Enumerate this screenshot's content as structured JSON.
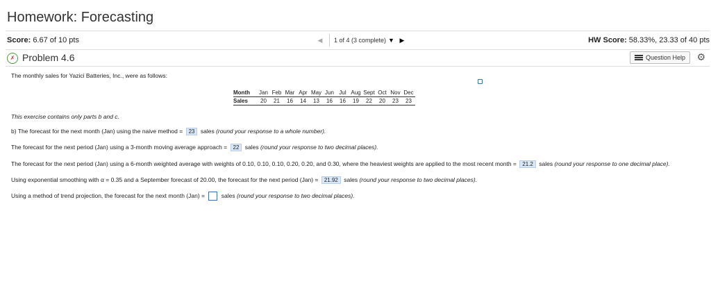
{
  "title": "Homework: Forecasting",
  "score": {
    "label": "Score:",
    "value": "6.67 of 10 pts"
  },
  "nav": {
    "position": "1 of 4 (3 complete)",
    "prev_icon": "◀",
    "next_icon": "▶",
    "caret": "▼"
  },
  "hw_score": {
    "label": "HW Score:",
    "value": "58.33%, 23.33 of 40 pts"
  },
  "problem": {
    "title": "Problem 4.6",
    "help_label": "Question Help"
  },
  "intro": "The monthly sales for Yazici Batteries, Inc., were as follows:",
  "table": {
    "row1_label": "Month",
    "row2_label": "Sales",
    "months": [
      "Jan",
      "Feb",
      "Mar",
      "Apr",
      "May",
      "Jun",
      "Jul",
      "Aug",
      "Sept",
      "Oct",
      "Nov",
      "Dec"
    ],
    "sales": [
      "20",
      "21",
      "16",
      "14",
      "13",
      "16",
      "16",
      "19",
      "22",
      "20",
      "23",
      "23"
    ]
  },
  "note": "This exercise contains only parts b and c.",
  "lines": {
    "b_prefix": "b) The forecast for the next month (Jan) using the naive method =",
    "b_answer": "23",
    "b_suffix_plain": "sales",
    "b_suffix_it": "(round your response to a whole number).",
    "ma_prefix": "The forecast for the next period (Jan) using a 3-month moving average approach =",
    "ma_answer": "22",
    "ma_suffix_plain": "sales",
    "ma_suffix_it": "(round your response to two decimal places).",
    "wma_prefix": "The forecast for the next period (Jan) using a 6-month weighted average with weights of 0.10, 0.10, 0.10, 0.20, 0.20, and 0.30, where the heaviest weights are applied to the most recent month =",
    "wma_answer": "21.2",
    "wma_suffix_plain": "sales",
    "wma_suffix_it": "(round your response to one decimal place).",
    "exp_prefix": "Using exponential smoothing with α = 0.35 and a September forecast of 20.00, the forecast for the next period (Jan) =",
    "exp_answer": "21.92",
    "exp_suffix_plain": "sales",
    "exp_suffix_it": "(round your response to two decimal places).",
    "trend_prefix": "Using a method of trend projection, the forecast for the next month (Jan) =",
    "trend_suffix_plain": "sales",
    "trend_suffix_it": "(round your response to two decimal places)."
  }
}
